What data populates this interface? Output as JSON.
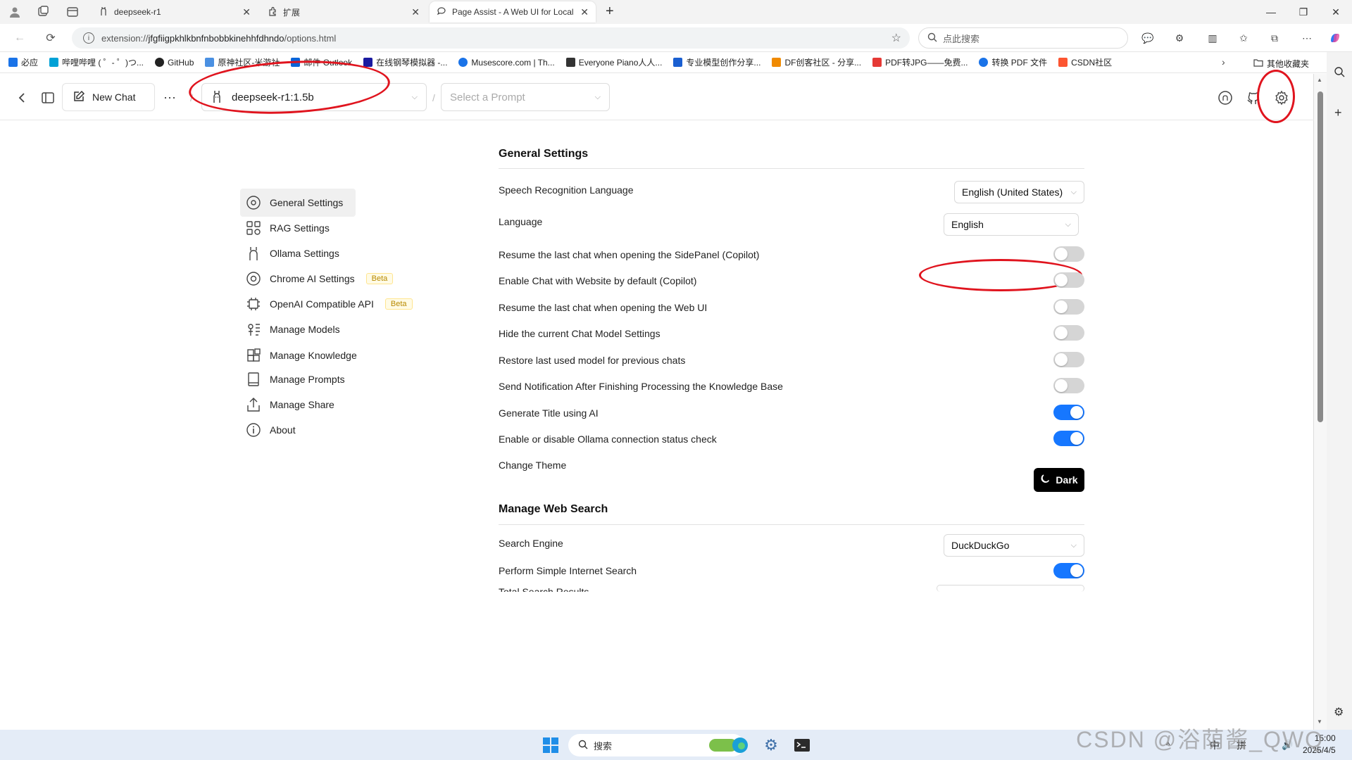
{
  "tabs": [
    {
      "title": "deepseek-r1",
      "active": false
    },
    {
      "title": "扩展",
      "active": false
    },
    {
      "title": "Page Assist - A Web UI for Local A",
      "active": true
    }
  ],
  "address": {
    "scheme": "extension://",
    "host": "jfgfiigpkhlkbnfnbobbkinehhfdhndo",
    "path": "/options.html",
    "search_placeholder": "点此搜索"
  },
  "bookmarks": [
    {
      "label": "必应",
      "color": "#1a73e8"
    },
    {
      "label": "哔哩哔哩 ( ゜- ゜)つ...",
      "color": "#00a1d6"
    },
    {
      "label": "GitHub",
      "color": "#222222"
    },
    {
      "label": "原神社区-米游社",
      "color": "#4a90e2"
    },
    {
      "label": "邮件 Outlook",
      "color": "#0a64d8"
    },
    {
      "label": "在线钢琴模拟器 -...",
      "color": "#1a1aa0"
    },
    {
      "label": "Musescore.com | Th...",
      "color": "#1a73e8"
    },
    {
      "label": "Everyone Piano人人...",
      "color": "#333333"
    },
    {
      "label": "专业模型创作分享...",
      "color": "#1a5fd1"
    },
    {
      "label": "DF创客社区 - 分享...",
      "color": "#f08a00"
    },
    {
      "label": "PDF转JPG——免费...",
      "color": "#e53935"
    },
    {
      "label": "转换 PDF 文件",
      "color": "#1a73e8"
    },
    {
      "label": "CSDN社区",
      "color": "#fc5531"
    }
  ],
  "bookmarks_other": "其他收藏夹",
  "header": {
    "new_chat": "New Chat",
    "model": "deepseek-r1:1.5b",
    "prompt_placeholder": "Select a Prompt"
  },
  "menu": [
    {
      "label": "General Settings",
      "icon": "general-settings-icon",
      "active": true
    },
    {
      "label": "RAG Settings",
      "icon": "rag-icon"
    },
    {
      "label": "Ollama Settings",
      "icon": "ollama-icon"
    },
    {
      "label": "Chrome AI Settings",
      "icon": "chrome-icon",
      "badge": "Beta"
    },
    {
      "label": "OpenAI Compatible API",
      "icon": "cpu-icon",
      "badge": "Beta"
    },
    {
      "label": "Manage Models",
      "icon": "models-icon"
    },
    {
      "label": "Manage Knowledge",
      "icon": "knowledge-icon"
    },
    {
      "label": "Manage Prompts",
      "icon": "prompts-icon"
    },
    {
      "label": "Manage Share",
      "icon": "share-icon"
    },
    {
      "label": "About",
      "icon": "info-icon"
    }
  ],
  "general": {
    "title": "General Settings",
    "speech_label": "Speech Recognition Language",
    "speech_value": "English (United States)",
    "language_label": "Language",
    "language_value": "English",
    "toggles": [
      {
        "label": "Resume the last chat when opening the SidePanel (Copilot)",
        "on": false
      },
      {
        "label": "Enable Chat with Website by default (Copilot)",
        "on": false
      },
      {
        "label": "Resume the last chat when opening the Web UI",
        "on": false
      },
      {
        "label": "Hide the current Chat Model Settings",
        "on": false
      },
      {
        "label": "Restore last used model for previous chats",
        "on": false
      },
      {
        "label": "Send Notification After Finishing Processing the Knowledge Base",
        "on": false
      },
      {
        "label": "Generate Title using AI",
        "on": true
      },
      {
        "label": "Enable or disable Ollama connection status check",
        "on": true
      }
    ],
    "theme_label": "Change Theme",
    "theme_button": "Dark"
  },
  "web_search": {
    "title": "Manage Web Search",
    "engine_label": "Search Engine",
    "engine_value": "DuckDuckGo",
    "simple_label": "Perform Simple Internet Search",
    "simple_on": true,
    "total_label": "Total Search Results"
  },
  "taskbar": {
    "search_text": "搜索",
    "ime1": "中",
    "ime2": "拼",
    "time": "15:00",
    "date": "2025/4/5"
  },
  "watermark": "CSDN @浴荫酱_QWQ",
  "colors": {
    "accent": "#1677ff",
    "annotation": "#e0141e"
  }
}
